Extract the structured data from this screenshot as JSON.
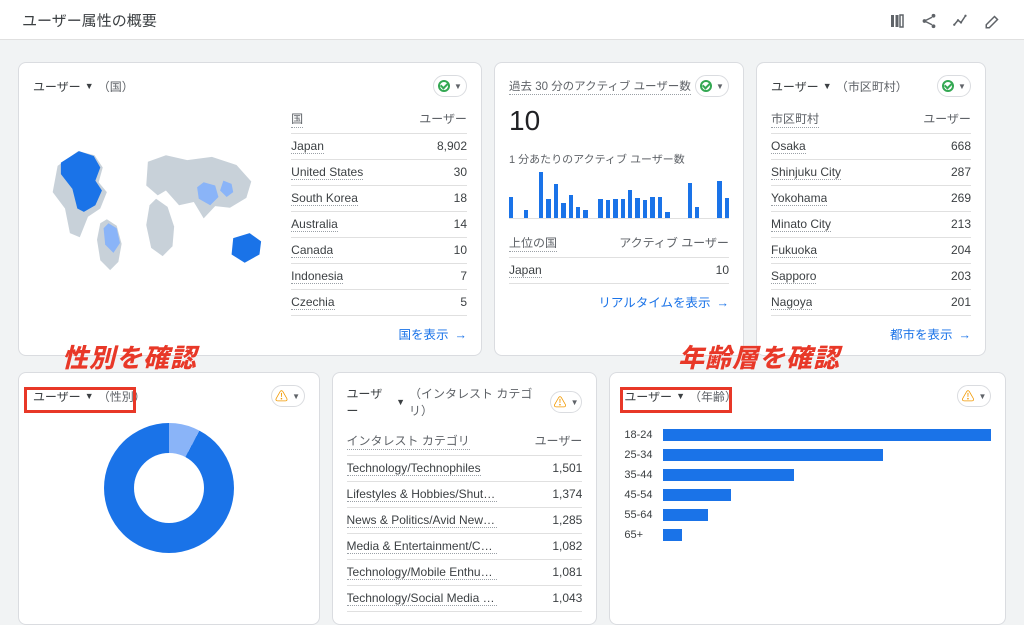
{
  "header": {
    "title": "ユーザー属性の概要"
  },
  "card_country": {
    "dim_main": "ユーザー",
    "dim_sub": "（国）",
    "col_dim": "国",
    "col_val": "ユーザー",
    "rows": [
      {
        "label": "Japan",
        "value": "8,902"
      },
      {
        "label": "United States",
        "value": "30"
      },
      {
        "label": "South Korea",
        "value": "18"
      },
      {
        "label": "Australia",
        "value": "14"
      },
      {
        "label": "Canada",
        "value": "10"
      },
      {
        "label": "Indonesia",
        "value": "7"
      },
      {
        "label": "Czechia",
        "value": "5"
      }
    ],
    "footer": "国を表示"
  },
  "card_realtime": {
    "title": "過去 30 分のアクティブ ユーザー数",
    "big": "10",
    "sub": "1 分あたりのアクティブ ユーザー数",
    "bars": [
      28,
      0,
      10,
      0,
      60,
      25,
      45,
      20,
      30,
      14,
      10,
      0,
      25,
      24,
      25,
      25,
      36,
      26,
      24,
      28,
      28,
      8,
      0,
      0,
      46,
      14,
      0,
      0,
      48,
      26
    ],
    "tbl_dim": "上位の国",
    "tbl_val": "アクティブ ユーザー",
    "rows": [
      {
        "label": "Japan",
        "value": "10"
      }
    ],
    "footer": "リアルタイムを表示"
  },
  "card_city": {
    "dim_main": "ユーザー",
    "dim_sub": "（市区町村）",
    "col_dim": "市区町村",
    "col_val": "ユーザー",
    "rows": [
      {
        "label": "Osaka",
        "value": "668"
      },
      {
        "label": "Shinjuku City",
        "value": "287"
      },
      {
        "label": "Yokohama",
        "value": "269"
      },
      {
        "label": "Minato City",
        "value": "213"
      },
      {
        "label": "Fukuoka",
        "value": "204"
      },
      {
        "label": "Sapporo",
        "value": "203"
      },
      {
        "label": "Nagoya",
        "value": "201"
      }
    ],
    "footer": "都市を表示"
  },
  "card_gender": {
    "dim_main": "ユーザー",
    "dim_sub": "（性別）"
  },
  "card_interest": {
    "dim_main": "ユーザー",
    "dim_sub": "（インタレスト カテゴリ）",
    "col_dim": "インタレスト カテゴリ",
    "col_val": "ユーザー",
    "rows": [
      {
        "label": "Technology/Technophiles",
        "value": "1,501"
      },
      {
        "label": "Lifestyles & Hobbies/Shutter...",
        "value": "1,374"
      },
      {
        "label": "News & Politics/Avid News ...",
        "value": "1,285"
      },
      {
        "label": "Media & Entertainment/Com...",
        "value": "1,082"
      },
      {
        "label": "Technology/Mobile Enthusia...",
        "value": "1,081"
      },
      {
        "label": "Technology/Social Media En...",
        "value": "1,043"
      }
    ]
  },
  "card_age": {
    "dim_main": "ユーザー",
    "dim_sub": "（年齢）",
    "labels": [
      "18-24",
      "25-34",
      "35-44",
      "45-54",
      "55-64",
      "65+"
    ]
  },
  "annotations": {
    "gender": "性別を確認",
    "age": "年齢層を確認"
  },
  "chart_data": [
    {
      "type": "bar",
      "title": "ユーザー（年齢）",
      "orientation": "horizontal",
      "categories": [
        "18-24",
        "25-34",
        "35-44",
        "45-54",
        "55-64",
        "65+"
      ],
      "values": [
        100,
        67,
        40,
        21,
        14,
        6
      ],
      "note": "values are relative (percent of longest bar); exact counts not shown"
    },
    {
      "type": "pie",
      "title": "ユーザー（性別）",
      "series": [
        {
          "name": "segment-a",
          "value": 92
        },
        {
          "name": "segment-b",
          "value": 8
        }
      ],
      "note": "donut; labels not visible in crop"
    },
    {
      "type": "bar",
      "title": "1 分あたりのアクティブ ユーザー数",
      "categories_label": "minute",
      "values": [
        28,
        0,
        10,
        0,
        60,
        25,
        45,
        20,
        30,
        14,
        10,
        0,
        25,
        24,
        25,
        25,
        36,
        26,
        24,
        28,
        28,
        8,
        0,
        0,
        46,
        14,
        0,
        0,
        48,
        26
      ],
      "note": "sparkline, y-axis unlabeled; values are estimated relative heights"
    },
    {
      "type": "table",
      "title": "ユーザー（国）",
      "columns": [
        "国",
        "ユーザー"
      ],
      "rows": [
        [
          "Japan",
          8902
        ],
        [
          "United States",
          30
        ],
        [
          "South Korea",
          18
        ],
        [
          "Australia",
          14
        ],
        [
          "Canada",
          10
        ],
        [
          "Indonesia",
          7
        ],
        [
          "Czechia",
          5
        ]
      ]
    },
    {
      "type": "table",
      "title": "ユーザー（市区町村）",
      "columns": [
        "市区町村",
        "ユーザー"
      ],
      "rows": [
        [
          "Osaka",
          668
        ],
        [
          "Shinjuku City",
          287
        ],
        [
          "Yokohama",
          269
        ],
        [
          "Minato City",
          213
        ],
        [
          "Fukuoka",
          204
        ],
        [
          "Sapporo",
          203
        ],
        [
          "Nagoya",
          201
        ]
      ]
    },
    {
      "type": "table",
      "title": "ユーザー（インタレスト カテゴリ）",
      "columns": [
        "インタレスト カテゴリ",
        "ユーザー"
      ],
      "rows": [
        [
          "Technology/Technophiles",
          1501
        ],
        [
          "Lifestyles & Hobbies/Shutter...",
          1374
        ],
        [
          "News & Politics/Avid News ...",
          1285
        ],
        [
          "Media & Entertainment/Com...",
          1082
        ],
        [
          "Technology/Mobile Enthusia...",
          1081
        ],
        [
          "Technology/Social Media En...",
          1043
        ]
      ]
    }
  ]
}
